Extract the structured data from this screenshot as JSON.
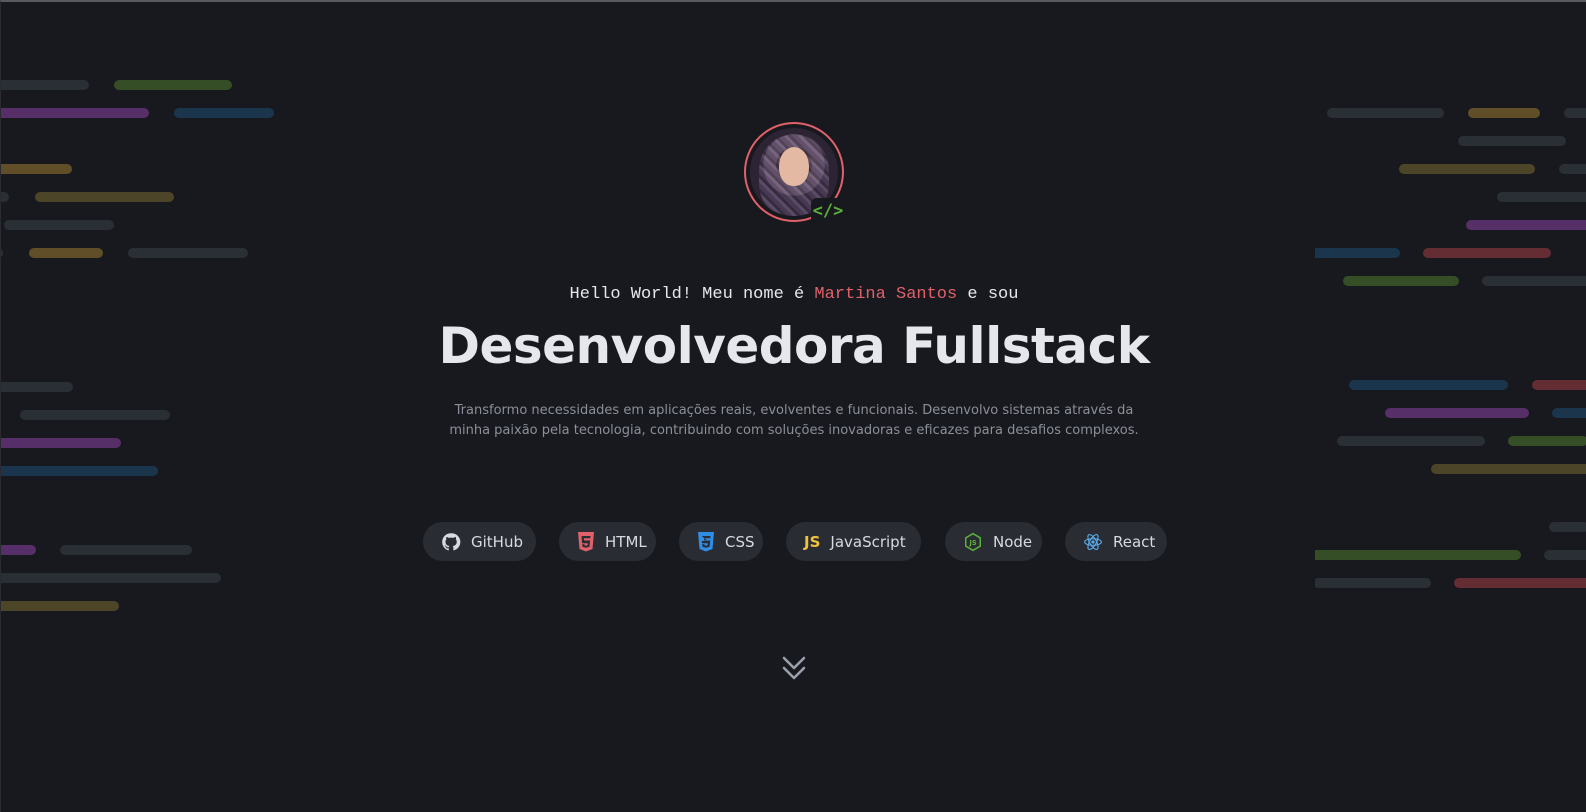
{
  "hero": {
    "intro_prefix": "Hello World! Meu nome é ",
    "intro_name": "Martina Santos",
    "intro_suffix": " e sou",
    "title": "Desenvolvedora Fullstack",
    "description_line1": "Transformo necessidades em aplicações reais, evolventes e funcionais. Desenvolvo sistemas através da",
    "description_line2": "minha paixão pela tecnologia, contribuindo com soluções inovadoras e eficazes para desafios complexos.",
    "badge": "</>"
  },
  "chips": [
    {
      "label": "GitHub",
      "icon": "github-icon",
      "color": "#d8dae0"
    },
    {
      "label": "HTML",
      "icon": "html5-icon",
      "color": "#e0616a"
    },
    {
      "label": "CSS",
      "icon": "css3-icon",
      "color": "#2f8de4"
    },
    {
      "label": "JavaScript",
      "icon": "javascript-icon",
      "color": "#f0c33c"
    },
    {
      "label": "Node",
      "icon": "nodejs-icon",
      "color": "#5ab038"
    },
    {
      "label": "React",
      "icon": "react-icon",
      "color": "#5aa9e6"
    }
  ],
  "js_badge": "JS",
  "colors": {
    "background": "#18191e",
    "accent": "#e0616a",
    "chip_background": "#2a2c34",
    "muted_text": "#8a8f99"
  }
}
